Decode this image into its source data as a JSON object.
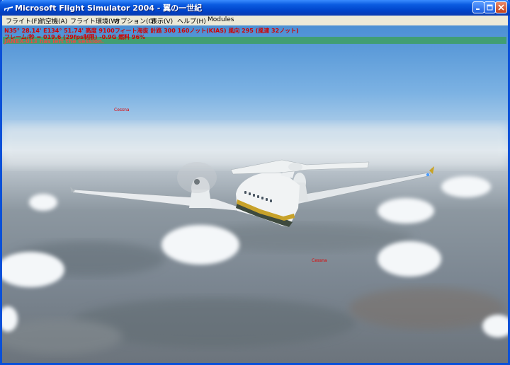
{
  "window": {
    "title": "Microsoft Flight Simulator 2004 - 翼の一世紀",
    "controls": [
      "minimize",
      "maximize",
      "close"
    ]
  },
  "menu": {
    "items": [
      "フライト(F)",
      "航空機(A)",
      "フライト環境(W)",
      "オプション(O)",
      "表示(V)",
      "ヘルプ(H)",
      "Modules"
    ]
  },
  "hud": {
    "line1": "N35° 28.14'  E134° 51.74'  高度 9100フィート海抜  針路 300  160ノット(KIAS)  風向 295 (風速 32ノット)",
    "line2": "フレーム/秒 = 019.6 (29fps制限)   -0.9G   燃料 96%",
    "message": "JANEX-013 has left the session."
  },
  "aircraft_labels": {
    "label1": "Cessna",
    "label2": "Cessna"
  },
  "colors": {
    "hud_text": "#d40000",
    "message_bar": "#3f9e68",
    "titlebar": "#0a5be0"
  }
}
